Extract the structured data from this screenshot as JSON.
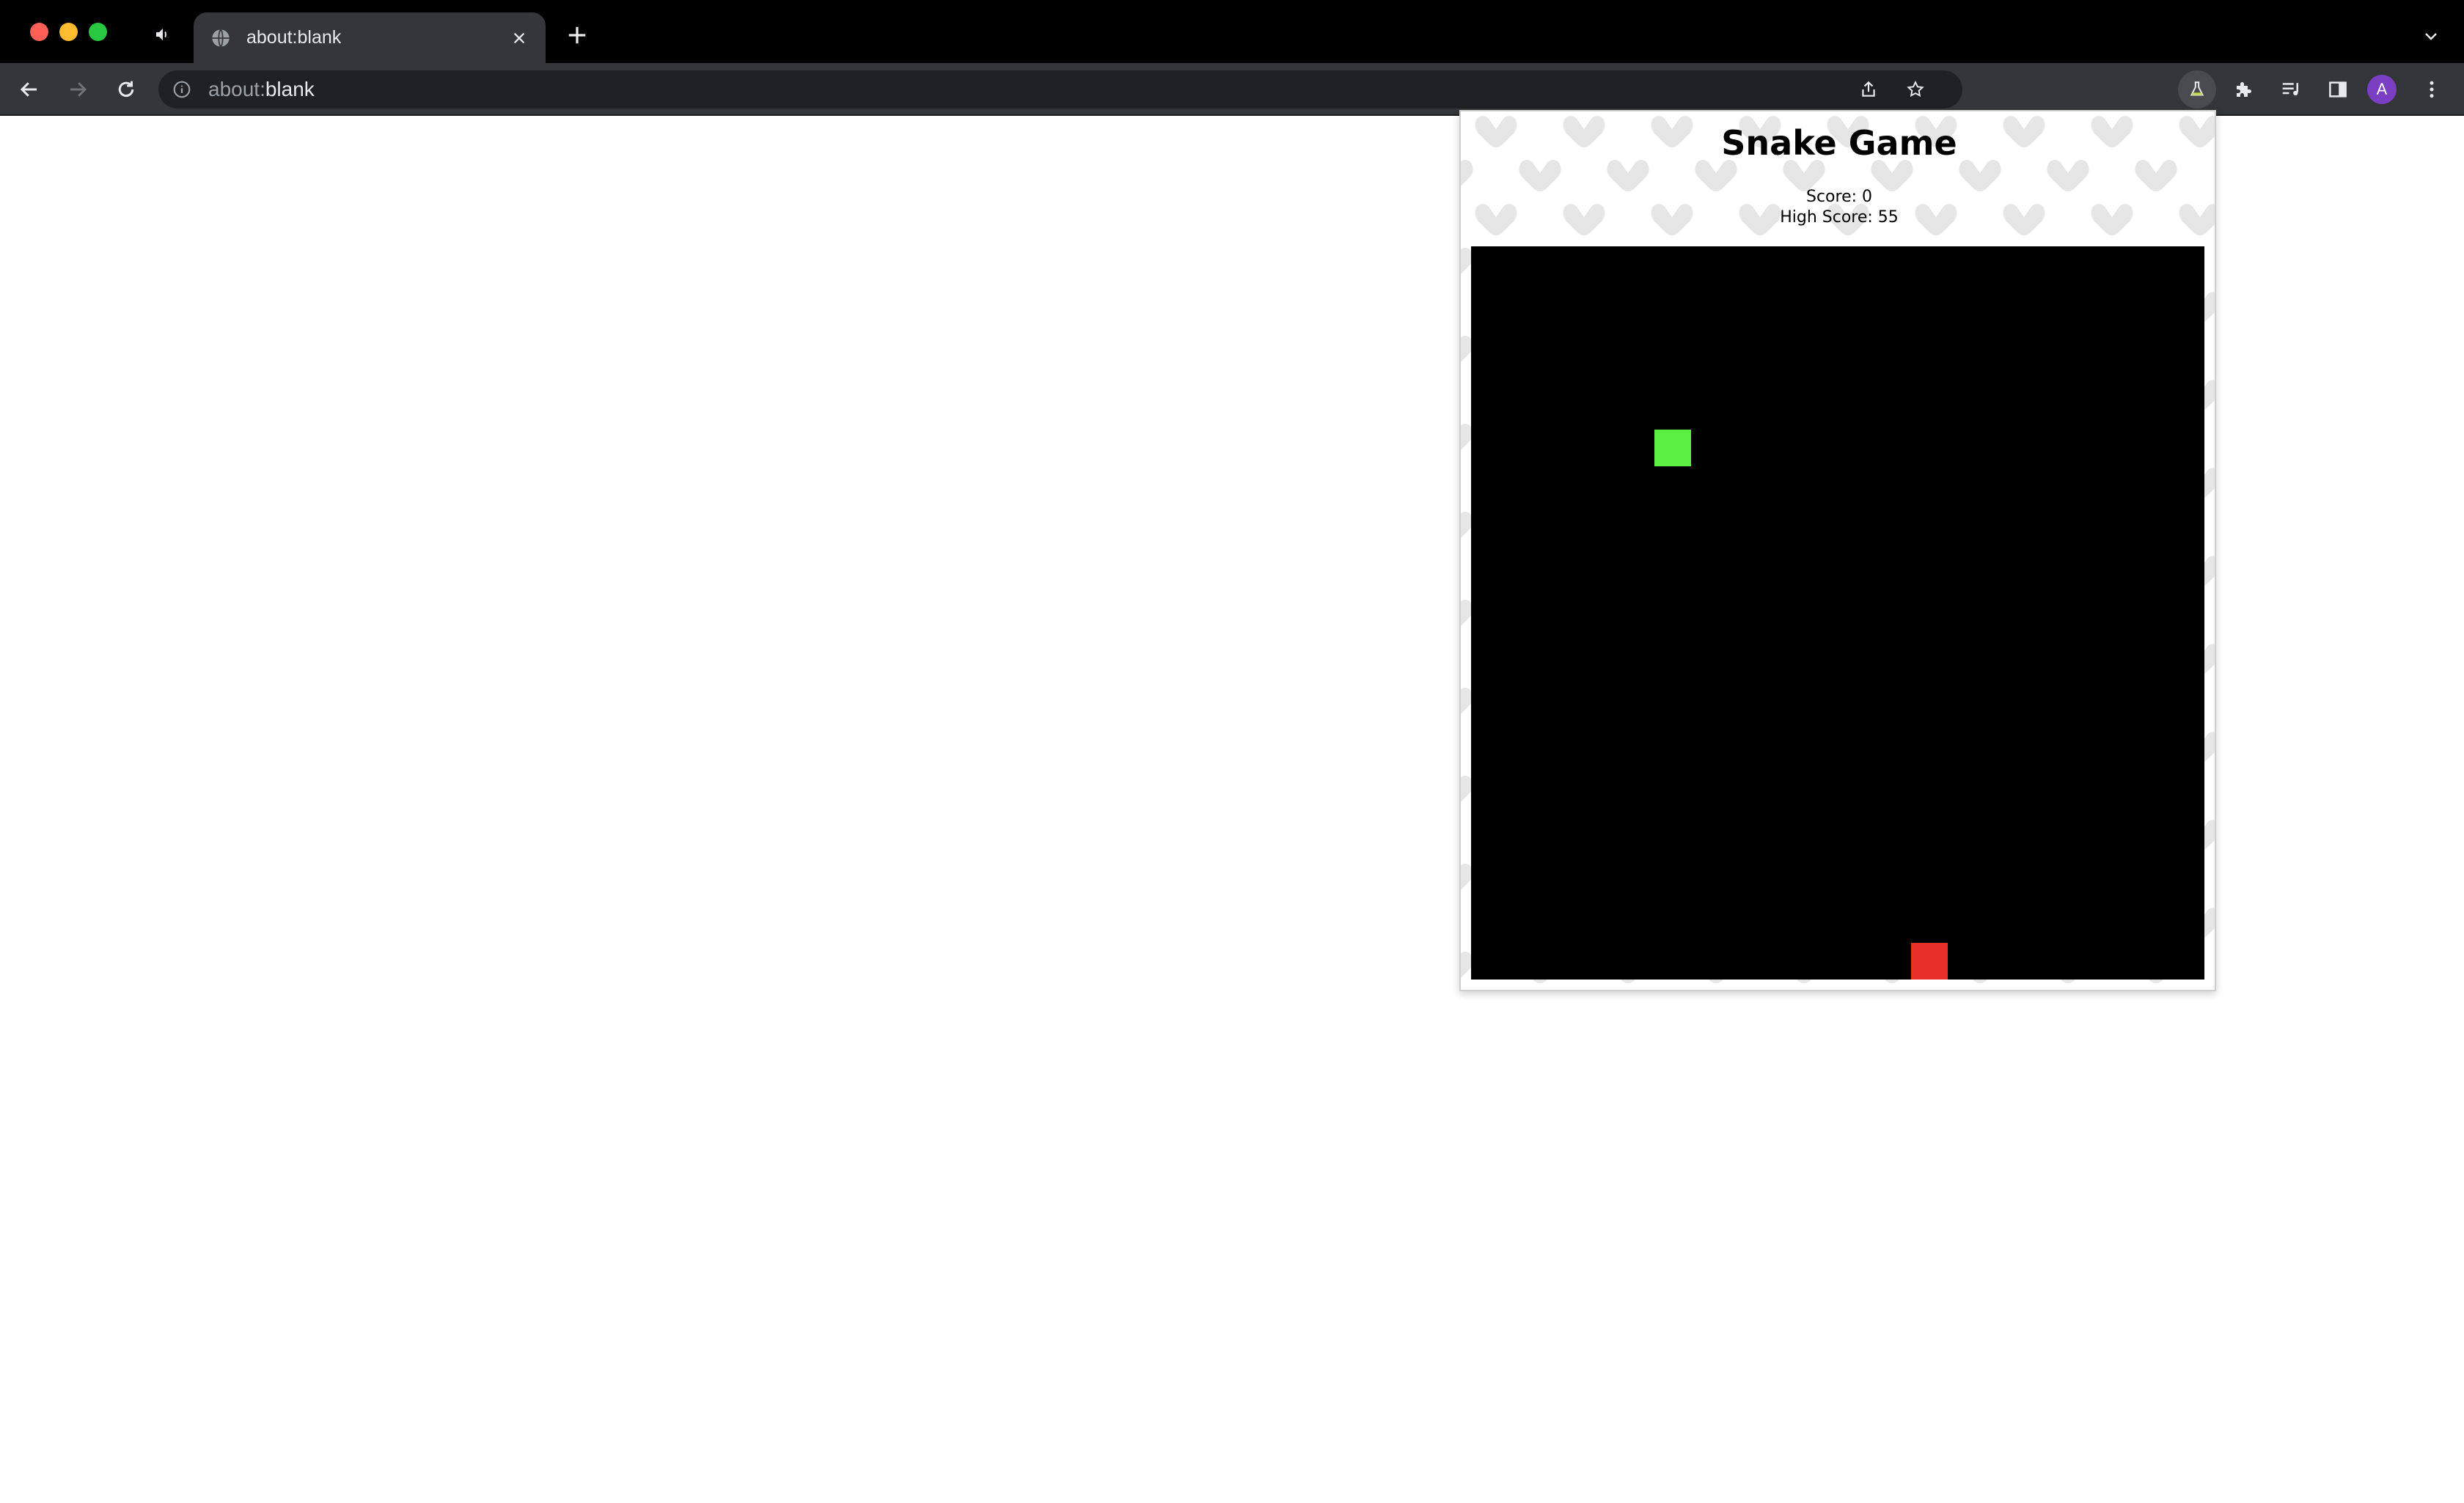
{
  "browser": {
    "tab": {
      "title": "about:blank"
    },
    "address_bar": {
      "scheme": "about:",
      "host": "blank"
    },
    "profile_initial": "A"
  },
  "game": {
    "title": "Snake Game",
    "score_label": "Score:",
    "score": 0,
    "high_score_label": "High Score:",
    "high_score": 55,
    "grid": {
      "columns": 20,
      "rows": 20
    },
    "snake": [
      {
        "col": 5,
        "row": 5
      }
    ],
    "food": {
      "col": 12,
      "row": 19
    },
    "colors": {
      "board": "#000000",
      "snake": "#5cf043",
      "food": "#e8302a",
      "pattern": "#e6e6e6"
    }
  }
}
